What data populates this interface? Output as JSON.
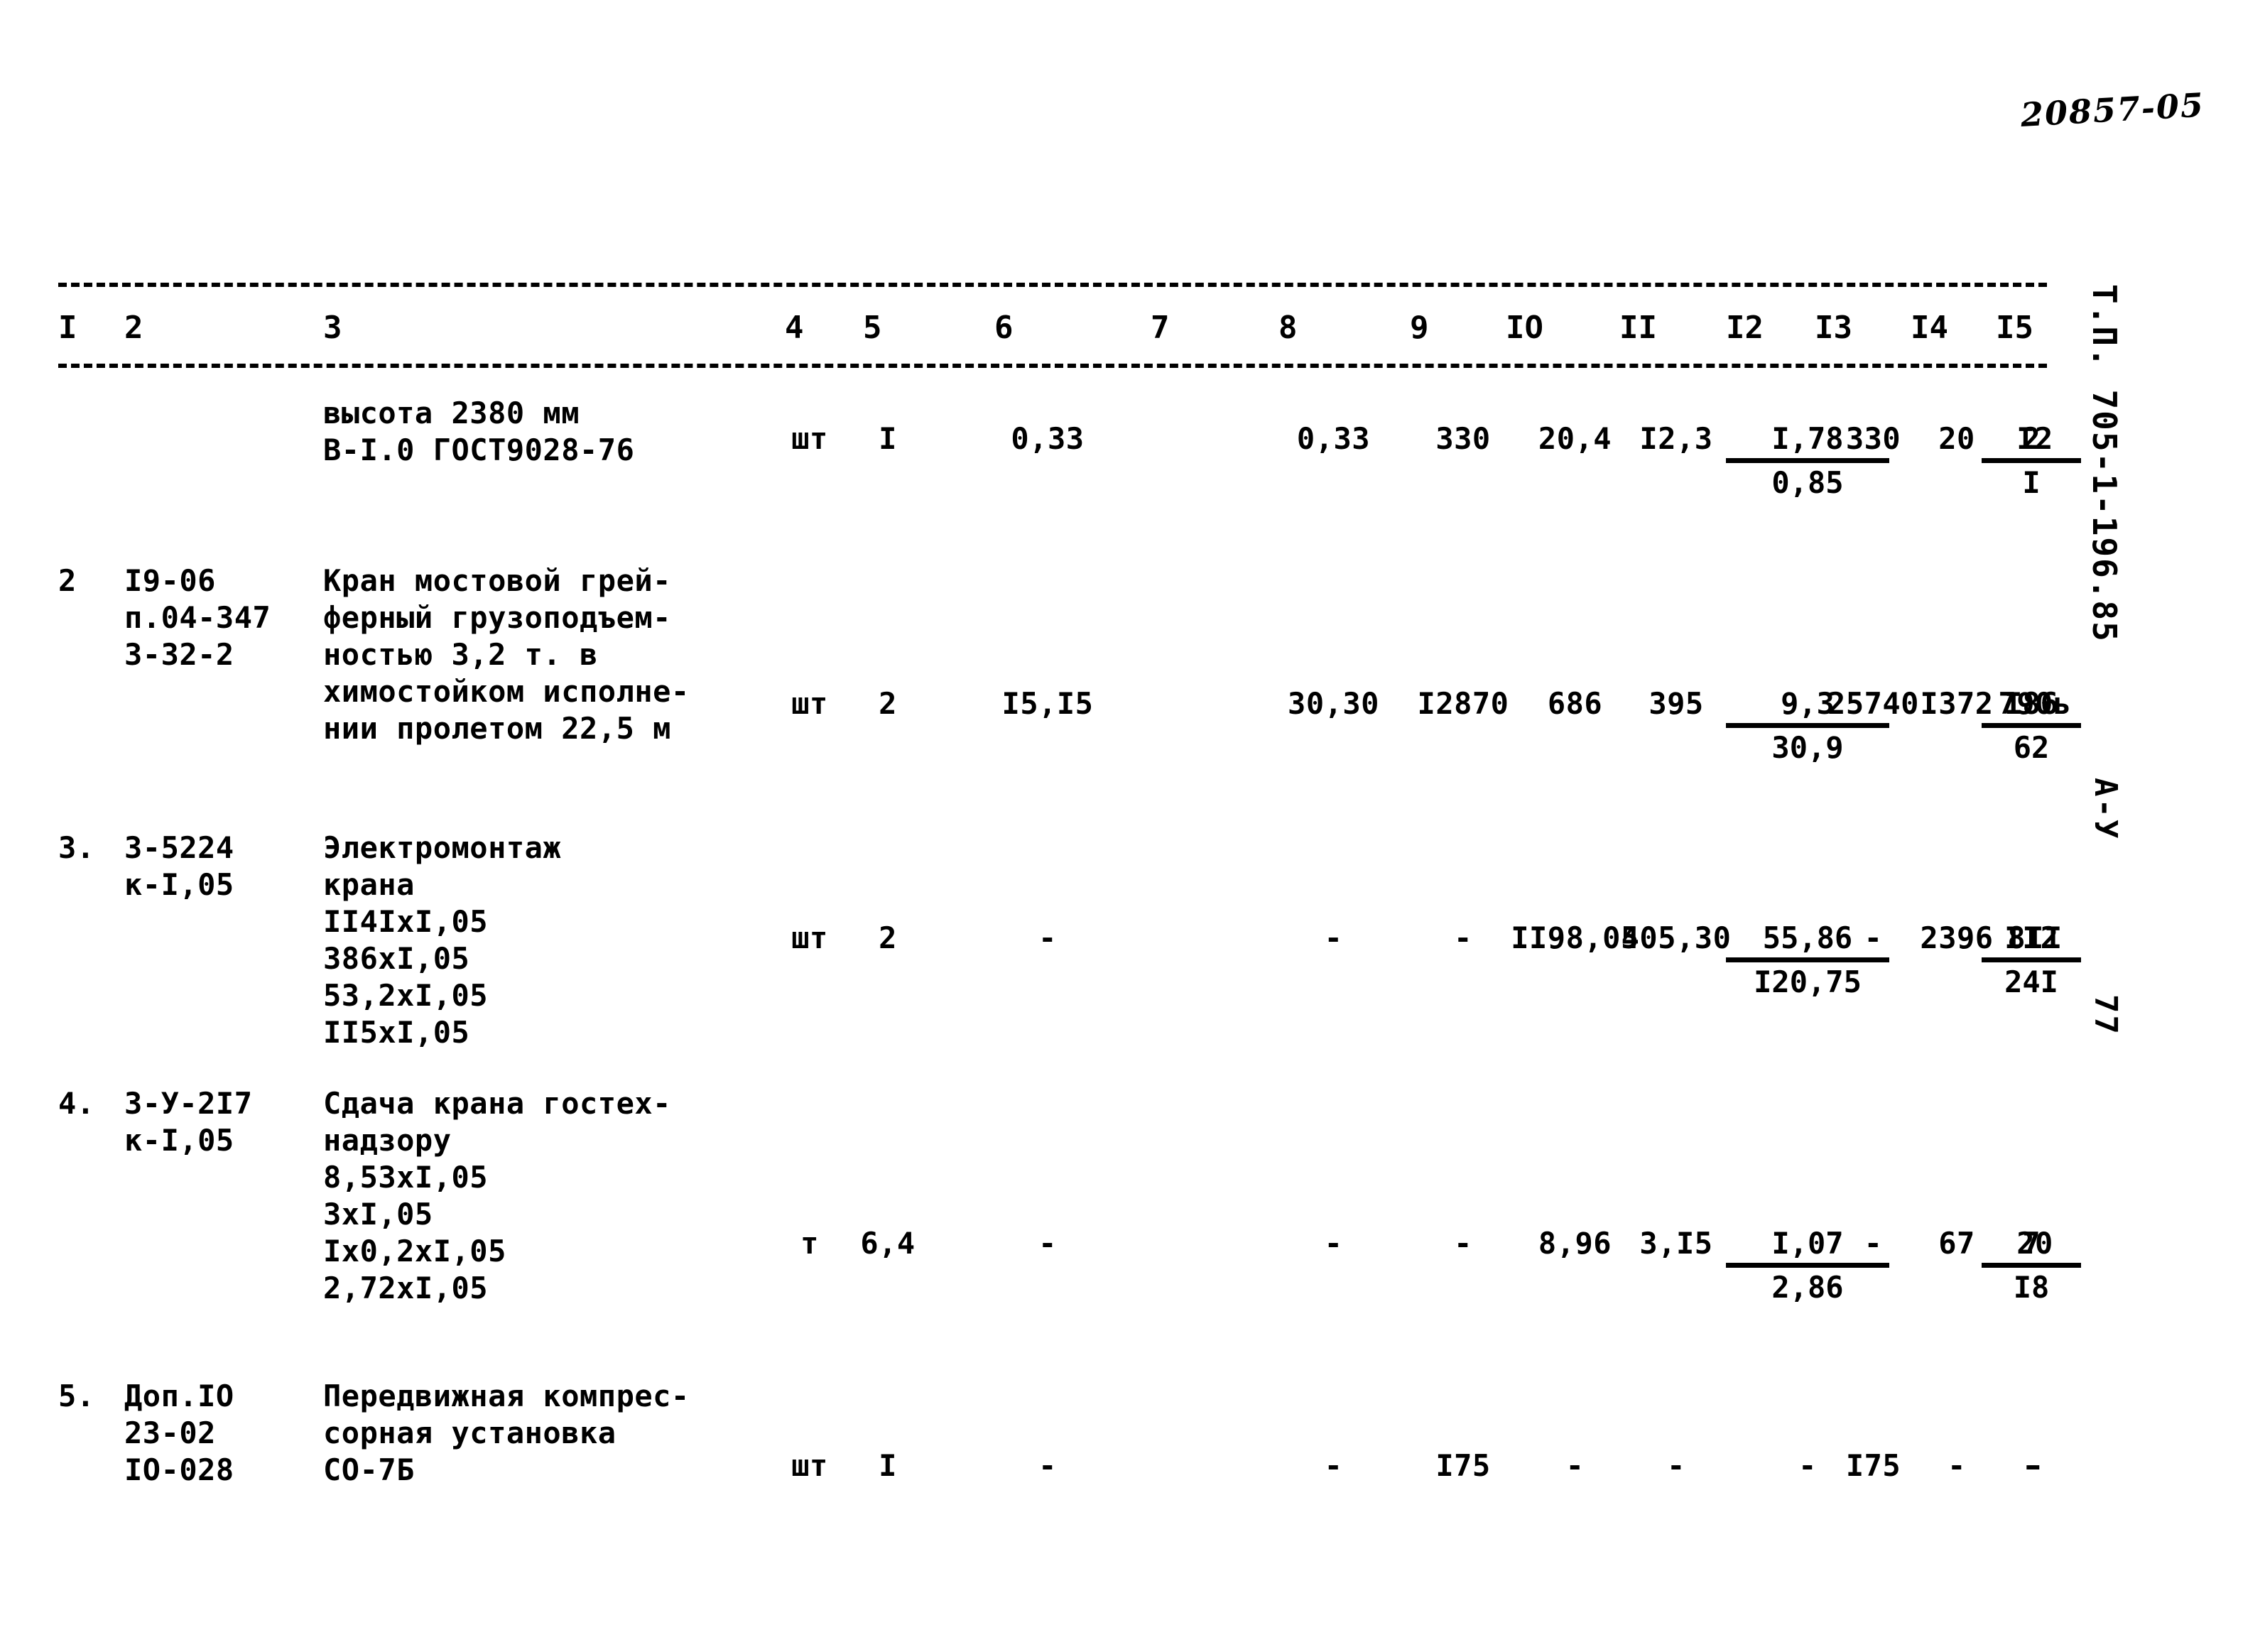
{
  "document": {
    "handwritten_number": "20857-05",
    "vertical_stamp_main": "Т.П. 705-1-196.85",
    "vertical_stamp_series": "А-У",
    "vertical_stamp_sheet": "77"
  },
  "table": {
    "column_numbers": [
      "I",
      "2",
      "3",
      "4",
      "5",
      "6",
      "7",
      "8",
      "9",
      "IO",
      "II",
      "I2",
      "I3",
      "I4",
      "I5"
    ],
    "rows": [
      {
        "no": "",
        "code_lines": [],
        "desc_lines": [
          "высота 2380 мм",
          "В-I.0 ГОСТ9028-76"
        ],
        "c4": "шт",
        "c5": "I",
        "c6": "0,33",
        "c7": "",
        "c8": "0,33",
        "c9": "330",
        "c10": "20,4",
        "c11": "I2,3",
        "c12_top": "I,78",
        "c12_bot": "0,85",
        "c12": "",
        "c13": "330",
        "c14": "20",
        "c15": "I2",
        "c16_top": "2",
        "c16_bot": "I"
      },
      {
        "no": "2",
        "code_lines": [
          "I9-06",
          "п.04-347",
          "3-32-2"
        ],
        "desc_lines": [
          "Кран мостовой грей-",
          "ферный грузоподъем-",
          "ностью 3,2 т. в",
          "химостойком исполне-",
          "нии пролетом 22,5 м"
        ],
        "c4": "шт",
        "c5": "2",
        "c6": "I5,I5",
        "c7": "",
        "c8": "30,30",
        "c9": "I2870",
        "c10": "686",
        "c11": "395",
        "c12_top": "9,3",
        "c12_bot": "30,9",
        "c12": "",
        "c13": "25740",
        "c14": "I372",
        "c15": "790ь",
        "c16_top": "I86",
        "c16_bot": "62"
      },
      {
        "no": "3.",
        "code_lines": [
          "3-5224",
          "к-I,05"
        ],
        "desc_lines": [
          "Электромонтаж",
          "крана",
          "II4IxI,05",
          "386xI,05",
          "53,2xI,05",
          "II5xI,05"
        ],
        "c4": "шт",
        "c5": "2",
        "c6": "-",
        "c7": "",
        "c8": "-",
        "c9": "-",
        "c10": "II98,05",
        "c11": "405,30",
        "c12_top": "55,86",
        "c12_bot": "I20,75",
        "c12": "",
        "c13": "-",
        "c14": "2396",
        "c15": "8II",
        "c16_top": "II2",
        "c16_bot": "24I"
      },
      {
        "no": "4.",
        "code_lines": [
          "3-У-2I7",
          "к-I,05"
        ],
        "desc_lines": [
          "Сдача крана гостех-",
          "надзору",
          "8,53xI,05",
          "3xI,05",
          "Ix0,2xI,05",
          "2,72xI,05"
        ],
        "c4": "т",
        "c5": "6,4",
        "c6": "-",
        "c7": "",
        "c8": "-",
        "c9": "-",
        "c10": "8,96",
        "c11": "3,I5",
        "c12_top": "I,07",
        "c12_bot": "2,86",
        "c12": "",
        "c13": "-",
        "c14": "67",
        "c15": "20",
        "c16_top": "7",
        "c16_bot": "I8"
      },
      {
        "no": "5.",
        "code_lines": [
          "Доп.IO",
          "23-02",
          "IO-028"
        ],
        "desc_lines": [
          "Передвижная компрес-",
          "сорная установка",
          "СО-7Б"
        ],
        "c4": "шт",
        "c5": "I",
        "c6": "-",
        "c7": "",
        "c8": "-",
        "c9": "I75",
        "c10": "-",
        "c11": "-",
        "c12": "-",
        "c12_top": "",
        "c12_bot": "",
        "c13": "I75",
        "c14": "-",
        "c15": "-",
        "c16_top": "-",
        "c16_bot": ""
      }
    ]
  }
}
